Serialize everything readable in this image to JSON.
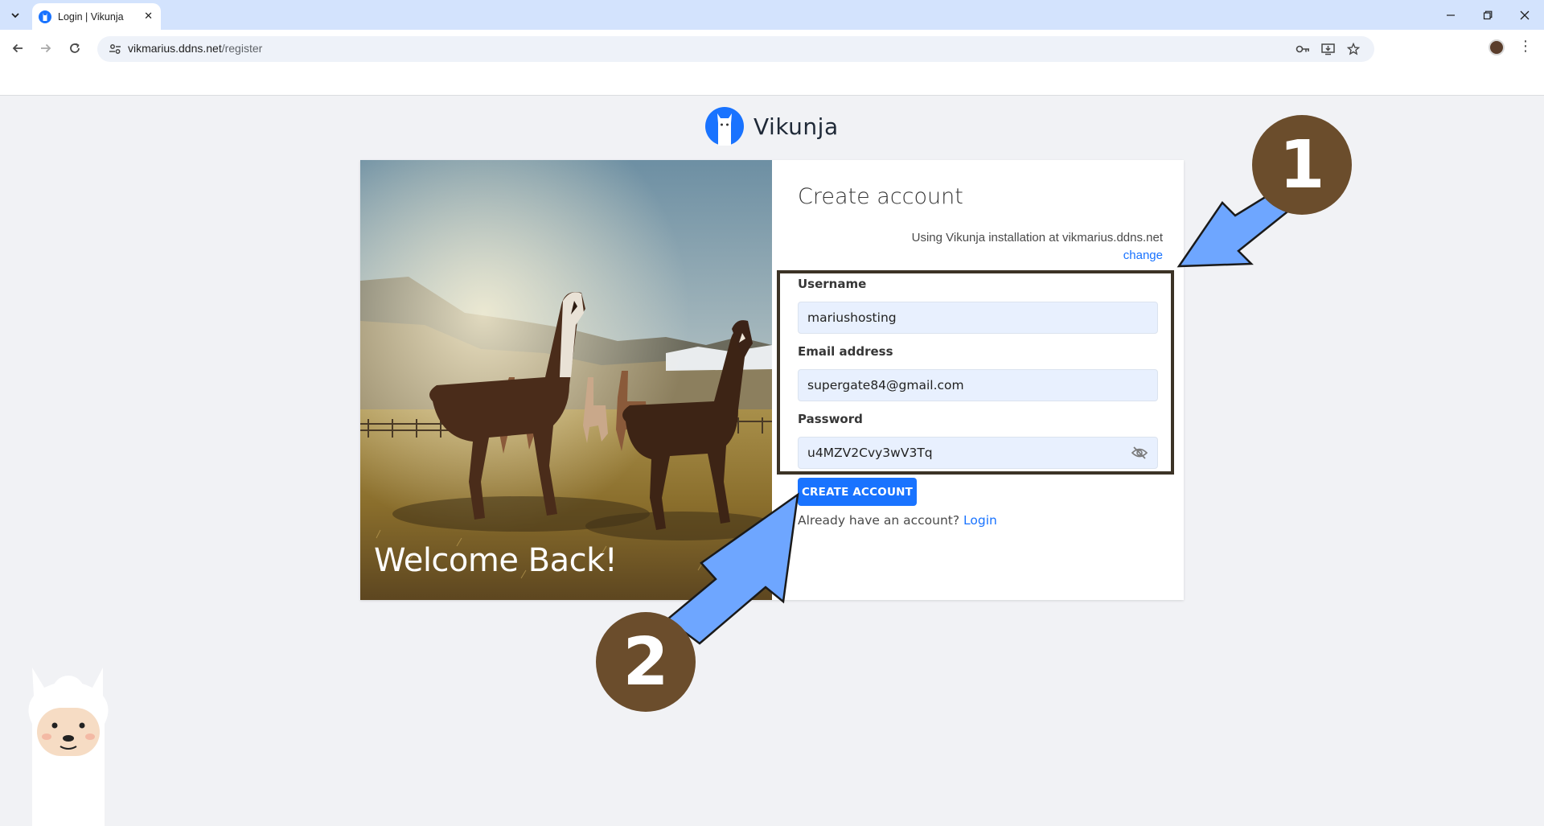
{
  "browser": {
    "tab_title": "Login | Vikunja",
    "url_host": "vikmarius.ddns.net",
    "url_path": "/register"
  },
  "app": {
    "name": "Vikunja"
  },
  "hero": {
    "text": "Welcome Back!"
  },
  "form": {
    "title": "Create account",
    "installation_text": "Using Vikunja installation at vikmarius.ddns.net",
    "change_link": "change",
    "username_label": "Username",
    "username_value": "mariushosting",
    "email_label": "Email address",
    "email_value": "supergate84@gmail.com",
    "password_label": "Password",
    "password_value": "u4MZV2Cvy3wV3Tq",
    "submit_label": "CREATE ACCOUNT",
    "already_text": "Already have an account?",
    "login_link": "Login"
  },
  "annotations": {
    "badge_1": "1",
    "badge_2": "2"
  },
  "colors": {
    "accent": "#1973ff",
    "annotation_badge": "#6b4d2c",
    "annotation_arrow": "#6ea6ff"
  }
}
